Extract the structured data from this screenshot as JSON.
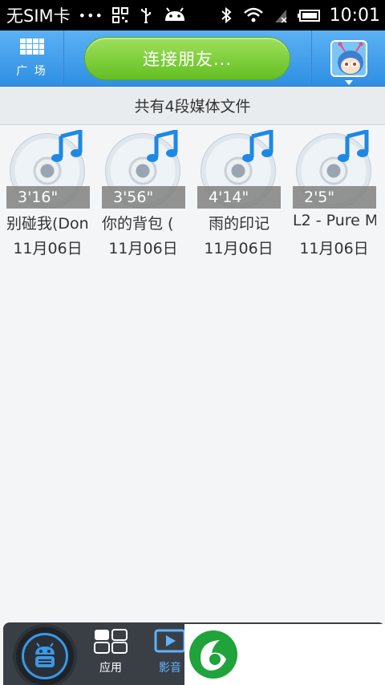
{
  "status_bar": {
    "carrier": "无SIM卡",
    "dots": "•••",
    "time": "10:01"
  },
  "top_bar": {
    "plaza_label": "广 场",
    "connect_button": "连接朋友..."
  },
  "header": {
    "summary": "共有4段媒体文件"
  },
  "media_items": [
    {
      "duration": "3'16\"",
      "title": "别碰我(Don",
      "date": "11月06日"
    },
    {
      "duration": "3'56\"",
      "title": "你的背包 (",
      "date": "11月06日"
    },
    {
      "duration": "4'14\"",
      "title": "雨的印记",
      "date": "11月06日"
    },
    {
      "duration": "2'5\"",
      "title": "L2 - Pure M",
      "date": "11月06日"
    }
  ],
  "bottom_bar": {
    "tabs": [
      {
        "label": "应用"
      },
      {
        "label": "影音"
      }
    ]
  },
  "colors": {
    "topbar_blue": "#3a97e6",
    "connect_green": "#76c93a",
    "status_black": "#000000",
    "media_active_blue": "#5fb3ff",
    "ad_logo_green": "#1fa33a"
  }
}
